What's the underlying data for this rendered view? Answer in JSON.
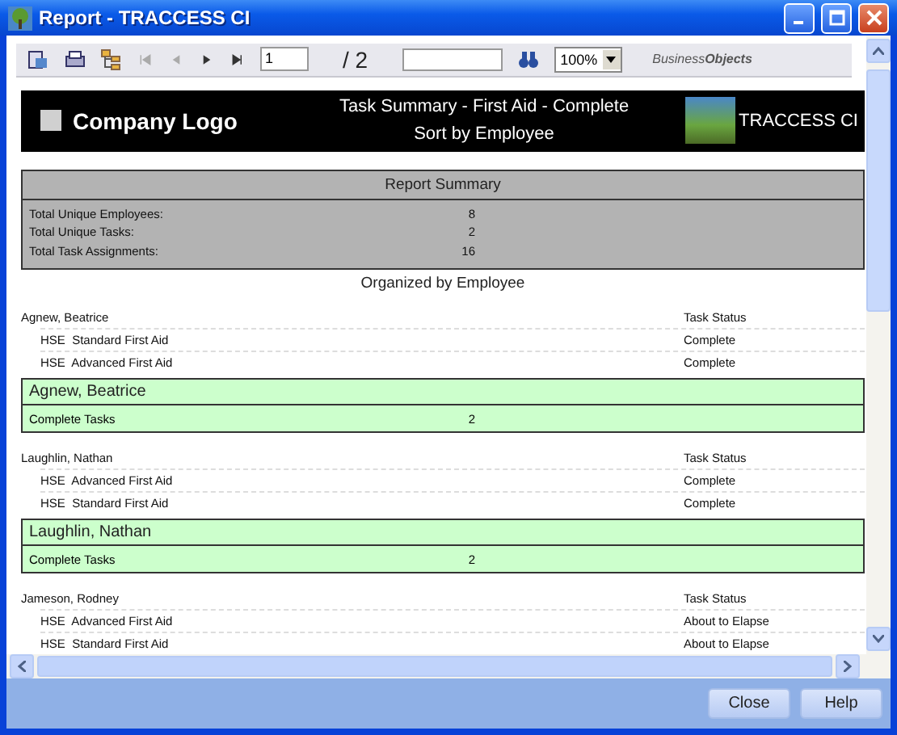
{
  "window": {
    "title": "Report - TRACCESS CI"
  },
  "toolbar": {
    "page_value": "1",
    "page_total": "/ 2",
    "zoom": "100%",
    "brand": "Business**Objects**"
  },
  "header": {
    "logo_text": "Company Logo",
    "title": "Task Summary - First Aid - Complete",
    "subtitle": "Sort by Employee",
    "product": "TRACCESS CI"
  },
  "summary": {
    "title": "Report Summary",
    "rows": [
      {
        "label": "Total Unique Employees:",
        "value": "8"
      },
      {
        "label": "Total Unique Tasks:",
        "value": "2"
      },
      {
        "label": "Total Task Assignments:",
        "value": "16"
      }
    ]
  },
  "section_title": "Organized by Employee",
  "groups": [
    {
      "employee": "Agnew, Beatrice",
      "status_heading": "Task Status",
      "tasks": [
        {
          "task": "HSE  Standard First Aid",
          "status": "Complete"
        },
        {
          "task": "HSE  Advanced First Aid",
          "status": "Complete"
        }
      ],
      "footer": {
        "name": "Agnew, Beatrice",
        "label": "Complete Tasks",
        "count": "2"
      }
    },
    {
      "employee": "Laughlin, Nathan",
      "status_heading": "Task Status",
      "tasks": [
        {
          "task": "HSE  Advanced First Aid",
          "status": "Complete"
        },
        {
          "task": "HSE  Standard First Aid",
          "status": "Complete"
        }
      ],
      "footer": {
        "name": "Laughlin, Nathan",
        "label": "Complete Tasks",
        "count": "2"
      }
    },
    {
      "employee": "Jameson, Rodney",
      "status_heading": "Task Status",
      "tasks": [
        {
          "task": "HSE  Advanced First Aid",
          "status": "About to Elapse"
        },
        {
          "task": "HSE  Standard First Aid",
          "status": "About to Elapse"
        }
      ]
    }
  ],
  "buttons": [
    "Close",
    "Help"
  ]
}
